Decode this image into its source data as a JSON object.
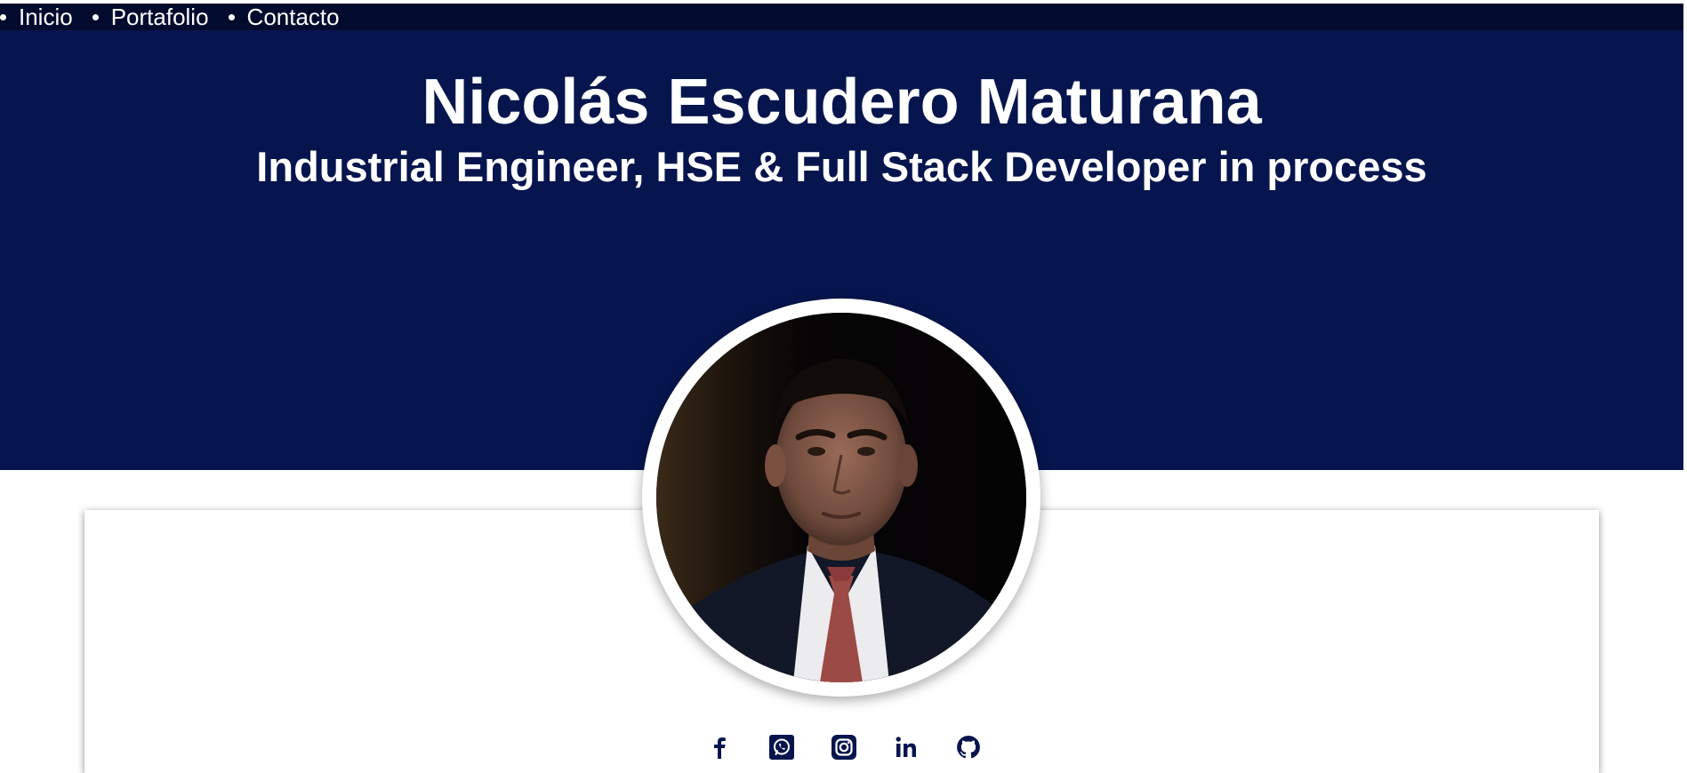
{
  "nav": {
    "items": [
      {
        "label": "Inicio"
      },
      {
        "label": "Portafolio"
      },
      {
        "label": "Contacto"
      }
    ]
  },
  "hero": {
    "title": "Nicolás Escudero Maturana",
    "subtitle": "Industrial Engineer, HSE & Full Stack Developer in process"
  },
  "profile": {
    "photo": "profile-photo"
  },
  "socials": [
    {
      "icon": "facebook-icon"
    },
    {
      "icon": "whatsapp-icon"
    },
    {
      "icon": "instagram-icon"
    },
    {
      "icon": "linkedin-icon"
    },
    {
      "icon": "github-icon"
    }
  ],
  "colors": {
    "nav_bg": "#020b2e",
    "hero_bg": "#06154e",
    "icon": "#06154e",
    "text_light": "#ffffff"
  }
}
